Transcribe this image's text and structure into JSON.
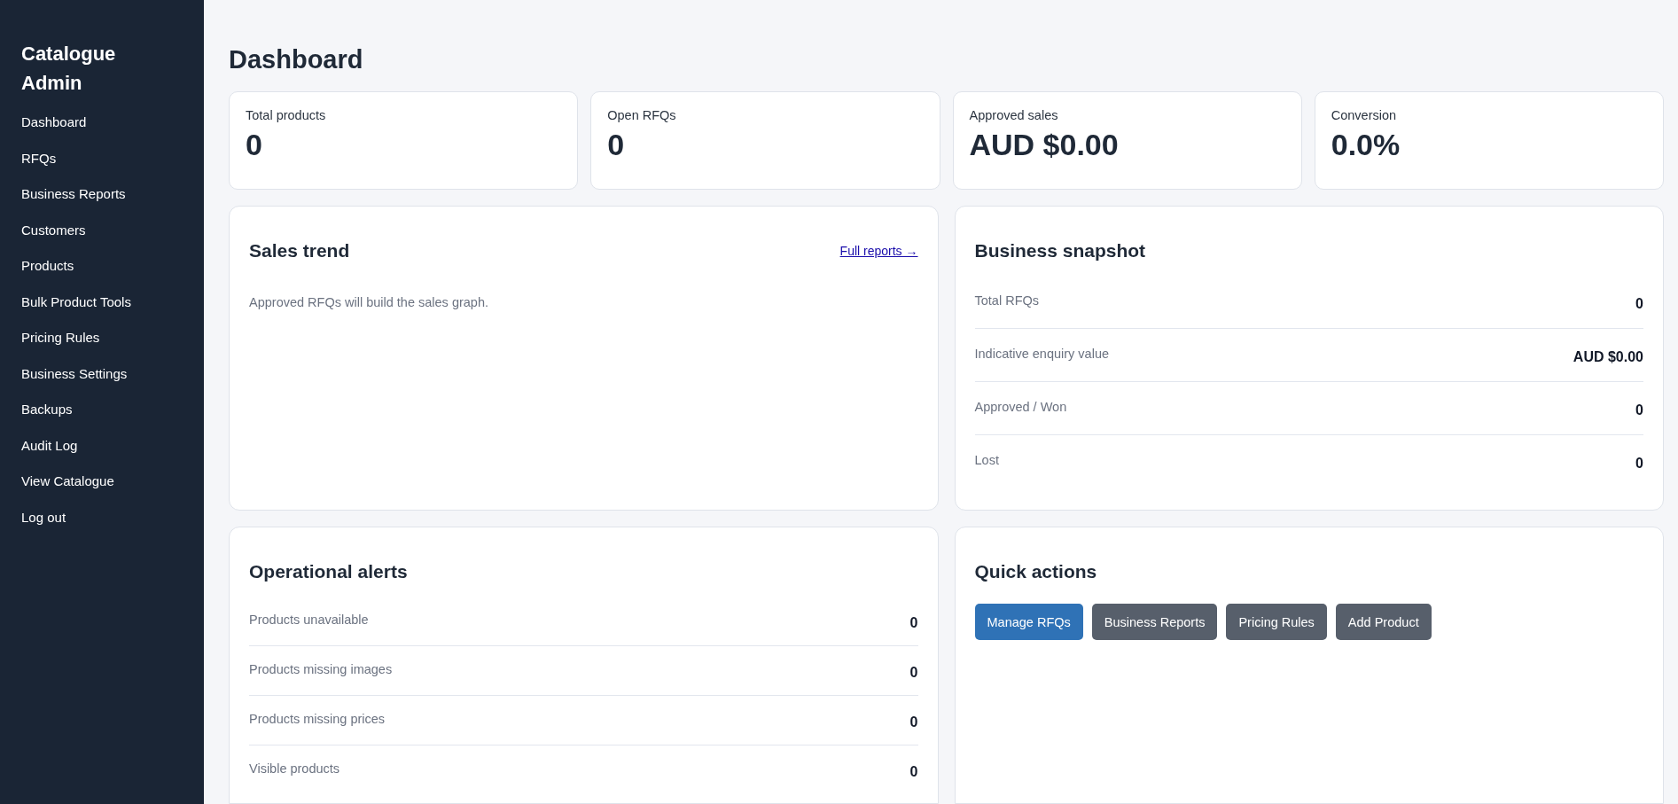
{
  "sidebar": {
    "brand": "Catalogue Admin",
    "items": [
      {
        "label": "Dashboard"
      },
      {
        "label": "RFQs"
      },
      {
        "label": "Business Reports"
      },
      {
        "label": "Customers"
      },
      {
        "label": "Products"
      },
      {
        "label": "Bulk Product Tools"
      },
      {
        "label": "Pricing Rules"
      },
      {
        "label": "Business Settings"
      },
      {
        "label": "Backups"
      },
      {
        "label": "Audit Log"
      },
      {
        "label": "View Catalogue"
      },
      {
        "label": "Log out"
      }
    ]
  },
  "page_title": "Dashboard",
  "stats": [
    {
      "label": "Total products",
      "value": "0"
    },
    {
      "label": "Open RFQs",
      "value": "0"
    },
    {
      "label": "Approved sales",
      "value": "AUD $0.00"
    },
    {
      "label": "Conversion",
      "value": "0.0%"
    }
  ],
  "sales_trend": {
    "title": "Sales trend",
    "link": "Full reports →",
    "message": "Approved RFQs will build the sales graph."
  },
  "business_snapshot": {
    "title": "Business snapshot",
    "rows": [
      {
        "label": "Total RFQs",
        "value": "0"
      },
      {
        "label": "Indicative enquiry value",
        "value": "AUD $0.00"
      },
      {
        "label": "Approved / Won",
        "value": "0"
      },
      {
        "label": "Lost",
        "value": "0"
      }
    ]
  },
  "operational_alerts": {
    "title": "Operational alerts",
    "rows": [
      {
        "label": "Products unavailable",
        "value": "0"
      },
      {
        "label": "Products missing images",
        "value": "0"
      },
      {
        "label": "Products missing prices",
        "value": "0"
      },
      {
        "label": "Visible products",
        "value": "0"
      }
    ]
  },
  "quick_actions": {
    "title": "Quick actions",
    "buttons": [
      {
        "label": "Manage RFQs",
        "kind": "primary"
      },
      {
        "label": "Business Reports",
        "kind": "secondary"
      },
      {
        "label": "Pricing Rules",
        "kind": "secondary"
      },
      {
        "label": "Add Product",
        "kind": "secondary"
      }
    ]
  }
}
